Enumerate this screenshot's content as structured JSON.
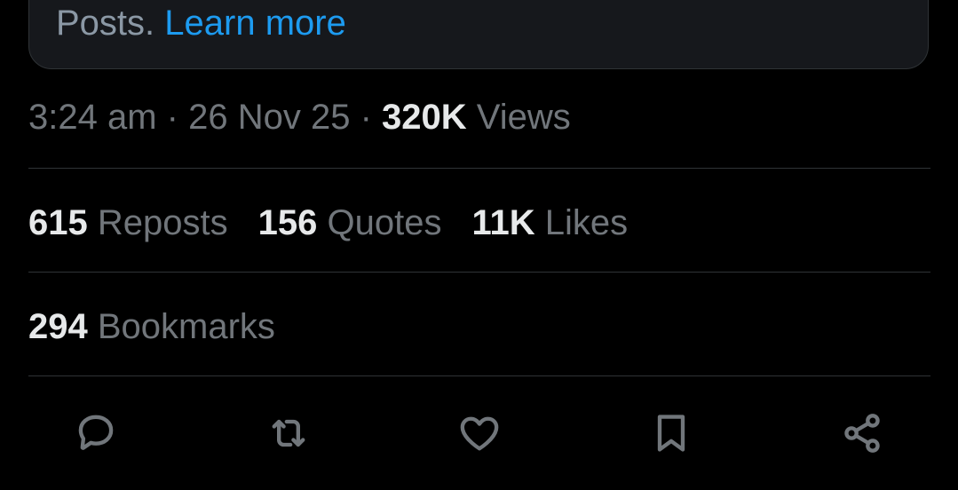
{
  "notice": {
    "text": "Posts.",
    "link_label": "Learn more"
  },
  "meta": {
    "time": "3:24 am",
    "separator1": "·",
    "date": "26 Nov 25",
    "separator2": "·",
    "views_count": "320K",
    "views_label": "Views"
  },
  "stats": {
    "reposts_count": "615",
    "reposts_label": "Reposts",
    "quotes_count": "156",
    "quotes_label": "Quotes",
    "likes_count": "11K",
    "likes_label": "Likes",
    "bookmarks_count": "294",
    "bookmarks_label": "Bookmarks"
  },
  "actions": [
    {
      "icon": "reply-icon"
    },
    {
      "icon": "repost-icon"
    },
    {
      "icon": "like-icon"
    },
    {
      "icon": "bookmark-icon"
    },
    {
      "icon": "share-icon"
    }
  ],
  "colors": {
    "background": "#000000",
    "card_background": "#16181c",
    "divider": "#2f3336",
    "primary_text": "#e7e9ea",
    "secondary_text": "#71767b",
    "link": "#1d9bf0"
  }
}
